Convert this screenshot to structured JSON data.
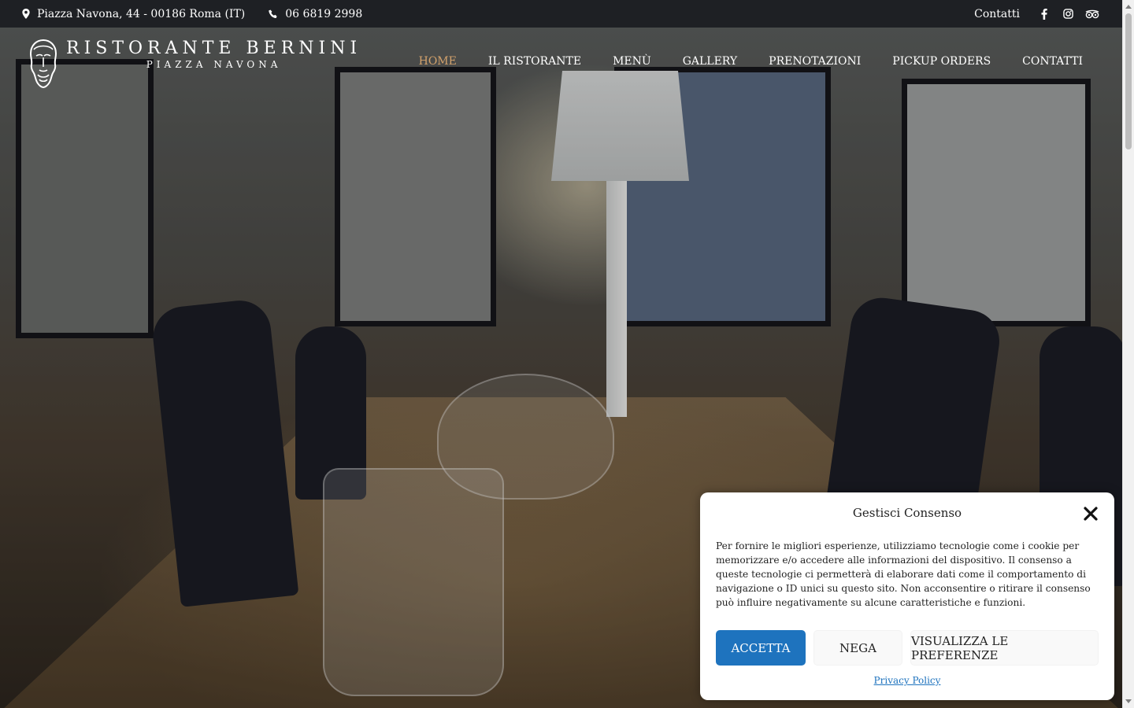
{
  "topbar": {
    "address": "Piazza Navona, 44 - 00186 Roma (IT)",
    "phone": "06 6819 2998",
    "contact_link": "Contatti",
    "social": [
      "facebook-icon",
      "instagram-icon",
      "tripadvisor-icon"
    ]
  },
  "header": {
    "logo_name": "Ristorante Bernini",
    "logo_sub": "Piazza Navona"
  },
  "nav": {
    "items": [
      {
        "label": "HOME",
        "active": true
      },
      {
        "label": "IL RISTORANTE",
        "active": false
      },
      {
        "label": "MENÙ",
        "active": false
      },
      {
        "label": "GALLERY",
        "active": false
      },
      {
        "label": "PRENOTAZIONI",
        "active": false
      },
      {
        "label": "PICKUP ORDERS",
        "active": false
      },
      {
        "label": "CONTATTI",
        "active": false
      }
    ]
  },
  "consent": {
    "title": "Gestisci Consenso",
    "body": "Per fornire le migliori esperienze, utilizziamo tecnologie come i cookie per memorizzare e/o accedere alle informazioni del dispositivo. Il consenso a queste tecnologie ci permetterà di elaborare dati come il comportamento di navigazione o ID unici su questo sito. Non acconsentire o ritirare il consenso può influire negativamente su alcune caratteristiche e funzioni.",
    "accept_label": "ACCETTA",
    "deny_label": "NEGA",
    "prefs_label": "VISUALIZZA LE PREFERENZE",
    "privacy_label": "Privacy Policy"
  },
  "colors": {
    "topbar_bg": "#1e2024",
    "nav_active": "#d3a26c",
    "accept_button": "#1e73be"
  }
}
